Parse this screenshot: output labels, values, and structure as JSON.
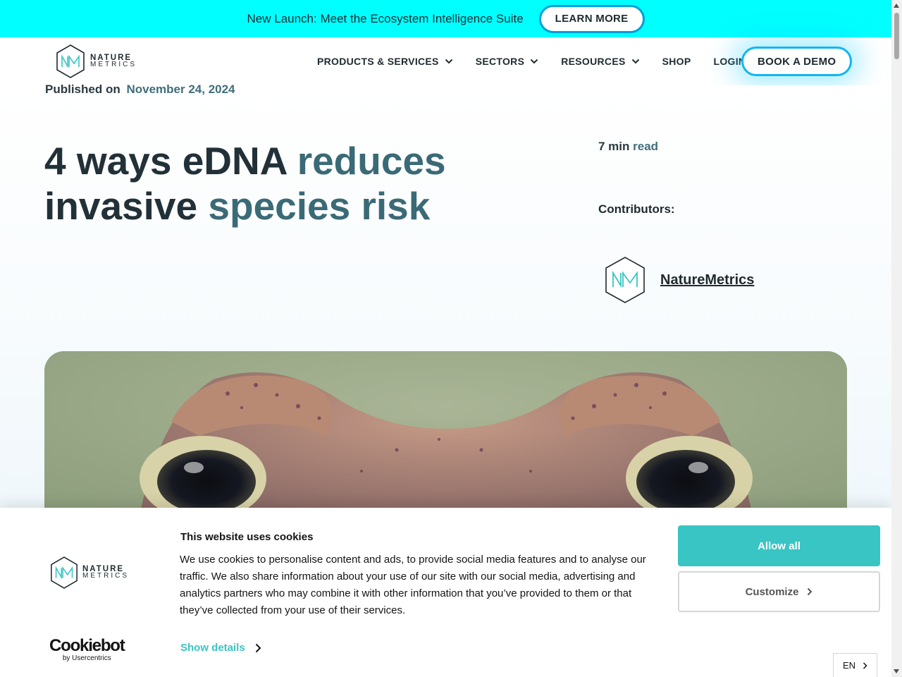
{
  "announcement": {
    "text": "New Launch: Meet the Ecosystem Intelligence Suite",
    "button_label": "LEARN MORE"
  },
  "header": {
    "logo": {
      "line1": "NATURE",
      "line2": "METRICS"
    },
    "nav": [
      {
        "label": "PRODUCTS & SERVICES",
        "has_dropdown": true
      },
      {
        "label": "SECTORS",
        "has_dropdown": true
      },
      {
        "label": "RESOURCES",
        "has_dropdown": true
      },
      {
        "label": "SHOP",
        "has_dropdown": false
      },
      {
        "label": "LOGIN",
        "has_dropdown": false
      }
    ],
    "demo_button": "BOOK A DEMO"
  },
  "article": {
    "published_label": "Published on",
    "published_date": "November 24, 2024",
    "title_part1": "4 ways eDNA ",
    "title_part2": "reduces",
    "title_part3": "invasive ",
    "title_part4": "species risk",
    "read_time_part1": "7 min",
    "read_time_part2": "read",
    "contributors_label": "Contributors:",
    "contributor_name": "NatureMetrics",
    "hero_image": "close-up of a toad's eyes"
  },
  "cookie_banner": {
    "logo": {
      "line1": "NATURE",
      "line2": "METRICS"
    },
    "title": "This website uses cookies",
    "body": "We use cookies to personalise content and ads, to provide social media features and to analyse our traffic. We also share information about your use of our site with our social media, advertising and analytics partners who may combine it with other information that you’ve provided to them or that they’ve collected from your use of their services.",
    "allow_all": "Allow all",
    "customize": "Customize",
    "show_details": "Show details",
    "cookiebot_brand": "Cookiebot",
    "cookiebot_sub": "by Usercentrics",
    "language": "EN"
  },
  "colors": {
    "announcement_bg": "#00ffff",
    "accent_teal": "#38c5c4",
    "title_highlight": "#3a6a76",
    "demo_border": "#11b6f0"
  }
}
